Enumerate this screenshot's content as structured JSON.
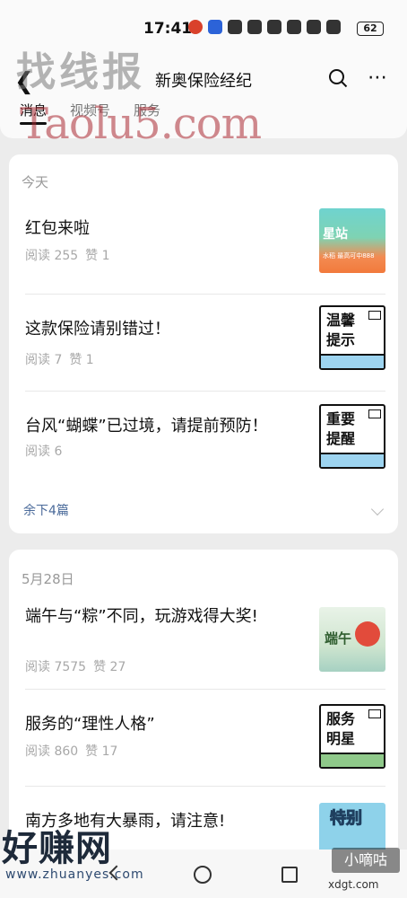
{
  "status_bar": {
    "time": "17:41",
    "battery": "62"
  },
  "header": {
    "title": "新奥保险经纪",
    "tabs": [
      {
        "label": "消息",
        "active": true
      },
      {
        "label": "视频号",
        "active": false
      },
      {
        "label": "服务",
        "active": false
      }
    ]
  },
  "watermarks": {
    "top_cn": "找线报",
    "top_en": "Taolu5.com",
    "bottom_cn": "好赚网",
    "bottom_en": "www.zhuanyes.com",
    "bottom_right": "小嘀咕",
    "bottom_right_url": "xdgt.com"
  },
  "groups": [
    {
      "date": "今天",
      "articles": [
        {
          "title": "红包来啦",
          "reads": "阅读 255",
          "likes": "赞 1",
          "thumb_text": "星站",
          "thumb_sub": "水稻 最高可中888"
        },
        {
          "title": "这款保险请别错过！",
          "reads": "阅读 7",
          "likes": "赞 1",
          "thumb_text": "温馨提示"
        },
        {
          "title": "台风“蝴蝶”已过境，请提前预防！",
          "reads": "阅读 6",
          "likes": "",
          "thumb_text": "重要提醒"
        }
      ],
      "more": "余下4篇"
    },
    {
      "date": "5月28日",
      "articles": [
        {
          "title": "端午与“粽”不同，玩游戏得大奖!",
          "reads": "阅读 7575",
          "likes": "赞 27",
          "thumb_text": "端午"
        },
        {
          "title": "服务的“理性人格”",
          "reads": "阅读 860",
          "likes": "赞 17",
          "thumb_text": "服务明星"
        },
        {
          "title": "南方多地有大暴雨，请注意!",
          "reads": "",
          "likes": "",
          "thumb_text": "特别"
        }
      ]
    }
  ],
  "colors": {
    "link": "#4a6a9a",
    "meta": "#a8a8a8",
    "background": "#ececec"
  }
}
